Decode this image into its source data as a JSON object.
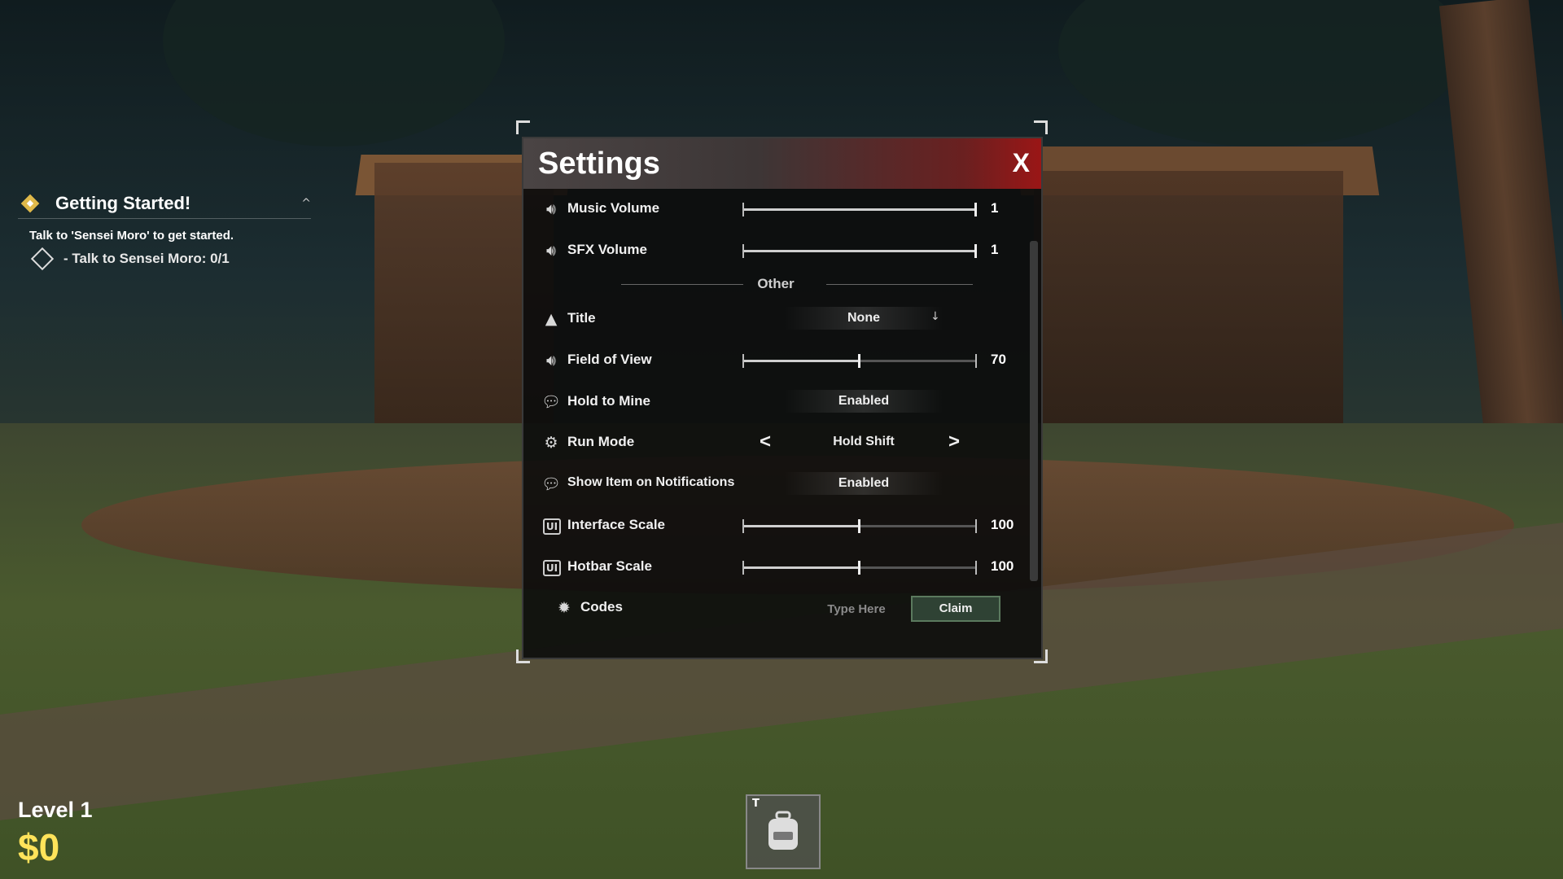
{
  "quest": {
    "title": "Getting Started!",
    "caret": "^",
    "description": "Talk to 'Sensei Moro' to get started.",
    "task": "- Talk to Sensei Moro: 0/1"
  },
  "player": {
    "level": "Level 1",
    "money": "$0"
  },
  "hotbar": {
    "key": "T",
    "icon": "backpack-icon"
  },
  "settings": {
    "title": "Settings",
    "close": "X",
    "music_volume": {
      "label": "Music Volume",
      "value": "1",
      "fraction": 1.0,
      "icon": "speaker-icon"
    },
    "sfx_volume": {
      "label": "SFX Volume",
      "value": "1",
      "fraction": 1.0,
      "icon": "speaker-icon"
    },
    "other_divider": "Other",
    "title_setting": {
      "label": "Title",
      "value": "None",
      "arrow": "↓",
      "icon": "hat-icon"
    },
    "fov": {
      "label": "Field of View",
      "value": "70",
      "fraction": 0.5,
      "icon": "speaker-icon"
    },
    "hold_to_mine": {
      "label": "Hold to Mine",
      "value": "Enabled",
      "icon": "chat-icon"
    },
    "run_mode": {
      "label": "Run Mode",
      "value": "Hold Shift",
      "prev": "<",
      "next": ">",
      "icon": "run-icon"
    },
    "show_item": {
      "label": "Show Item on Notifications",
      "value": "Enabled",
      "icon": "chat-icon"
    },
    "interface_scale": {
      "label": "Interface Scale",
      "value": "100",
      "fraction": 0.5,
      "icon_text": "UI"
    },
    "hotbar_scale": {
      "label": "Hotbar Scale",
      "value": "100",
      "fraction": 0.5,
      "icon_text": "UI"
    },
    "codes": {
      "label": "Codes",
      "placeholder": "Type Here",
      "claim": "Claim",
      "icon": "gear-star-icon"
    }
  },
  "colors": {
    "money": "#ffe35a",
    "header_red": "#9a1616",
    "claim_bg": "#2f4234"
  }
}
